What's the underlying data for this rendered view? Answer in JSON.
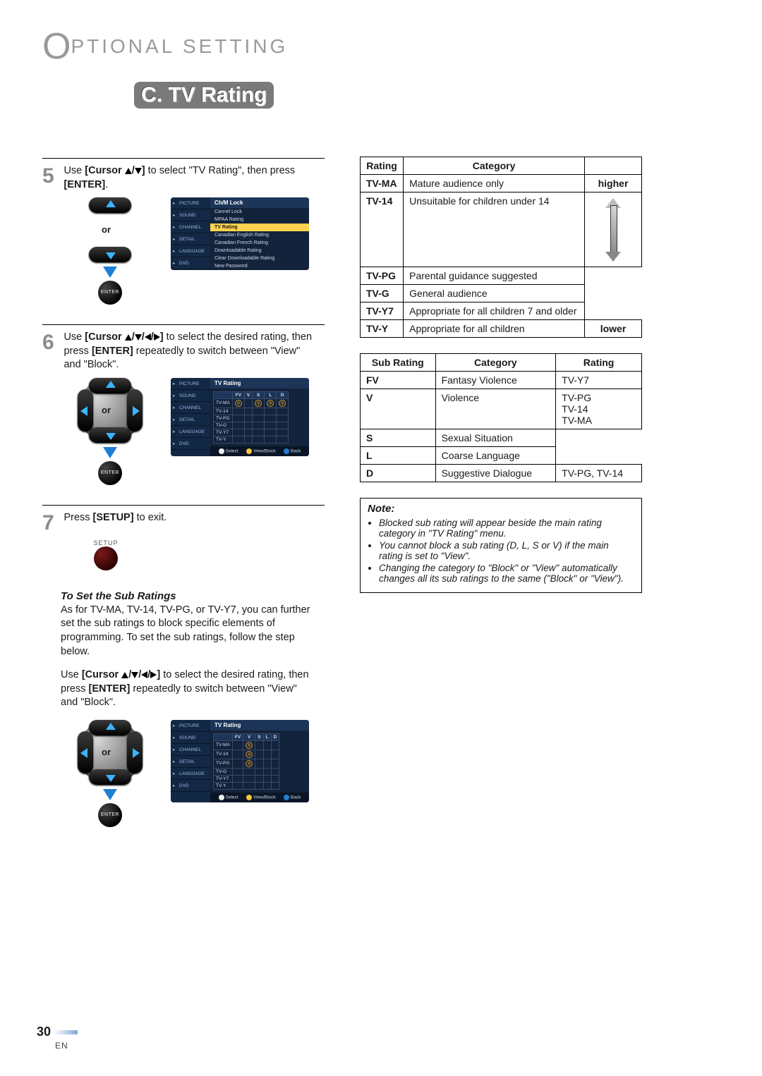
{
  "header": {
    "chapter_title": "PTIONAL   SETTING",
    "section_letter": "C.",
    "section_title": "TV Rating"
  },
  "steps": {
    "s5": {
      "num": "5",
      "text_pre": "Use ",
      "cursor_label": "[Cursor ",
      "text_mid": " to select \"TV Rating\", then press ",
      "enter_label": "[ENTER]",
      "text_post": "."
    },
    "s6": {
      "num": "6",
      "text_pre": "Use ",
      "cursor_label": "[Cursor ",
      "text_mid": " to select the desired rating, then press ",
      "enter_label": "[ENTER]",
      "text_post": " repeatedly to switch between \"View\" and \"Block\"."
    },
    "s7": {
      "num": "7",
      "text_pre": "Press ",
      "setup_label": "[SETUP]",
      "text_post": " to exit."
    }
  },
  "remote": {
    "or": "or",
    "enter": "ENTER",
    "setup": "SETUP"
  },
  "osd": {
    "tabs": [
      "PICTURE",
      "SOUND",
      "CHANNEL",
      "DETAIL",
      "LANGUAGE",
      "DVD"
    ],
    "menu_a": {
      "title": "Ch/M Lock",
      "items": [
        "Cannel Lock",
        "MPAA Rating",
        "TV Rating",
        "Canadian English Rating",
        "Canadian French Rating",
        "Downloadable Rating",
        "Clear Downloadable Rating",
        "New Password"
      ],
      "highlight": "TV Rating"
    },
    "menu_b": {
      "title": "TV Rating",
      "cols": [
        "",
        "FV",
        "V",
        "S",
        "L",
        "D"
      ],
      "rows": [
        "TV-MA",
        "TV-14",
        "TV-PG",
        "TV-G",
        "TV-Y7",
        "TV-Y"
      ],
      "footer": {
        "select": "Select",
        "view": "View/Block",
        "back": "Back"
      }
    },
    "menu_c": {
      "title": "TV Rating",
      "cols": [
        "",
        "FV",
        "V",
        "S",
        "L",
        "D"
      ],
      "rows": [
        "TV-MA",
        "TV-14",
        "TV-PG",
        "TV-G",
        "TV-Y7",
        "TV-Y"
      ],
      "footer": {
        "select": "Select",
        "view": "View/Block",
        "back": "Back"
      }
    }
  },
  "sub": {
    "heading": "To Set the Sub Ratings",
    "para1": "As for TV-MA, TV-14, TV-PG, or TV-Y7, you can further set the sub ratings to block specific elements of programming. To set the sub ratings, follow the step below.",
    "para2_pre": "Use ",
    "para2_cursor": "[Cursor ",
    "para2_mid": " to select the desired rating, then press ",
    "para2_enter": "[ENTER]",
    "para2_post": " repeatedly to switch between \"View\" and \"Block\"."
  },
  "rating_table": {
    "headers": [
      "Rating",
      "Category",
      ""
    ],
    "top_label": "higher",
    "bottom_label": "lower",
    "rows": [
      {
        "r": "TV-MA",
        "c": "Mature audience only"
      },
      {
        "r": "TV-14",
        "c": "Unsuitable for children under 14"
      },
      {
        "r": "TV-PG",
        "c": "Parental guidance suggested"
      },
      {
        "r": "TV-G",
        "c": "General audience"
      },
      {
        "r": "TV-Y7",
        "c": "Appropriate for all children 7 and older"
      },
      {
        "r": "TV-Y",
        "c": "Appropriate for all children"
      }
    ]
  },
  "sub_table": {
    "headers": [
      "Sub Rating",
      "Category",
      "Rating"
    ],
    "rows": [
      {
        "s": "FV",
        "c": "Fantasy Violence",
        "r": "TV-Y7"
      },
      {
        "s": "V",
        "c": "Violence",
        "r": ""
      },
      {
        "s": "S",
        "c": "Sexual Situation",
        "r": ""
      },
      {
        "s": "L",
        "c": "Coarse Language",
        "r": ""
      },
      {
        "s": "D",
        "c": "Suggestive Dialogue",
        "r": "TV-PG, TV-14"
      }
    ],
    "merged_ratings": "TV-PG\nTV-14\nTV-MA"
  },
  "note": {
    "title": "Note:",
    "items": [
      "Blocked sub rating will appear beside the main rating category in \"TV Rating\" menu.",
      "You cannot block a sub rating (D, L, S or V) if the main rating is set to \"View\".",
      "Changing the category to \"Block\" or \"View\" automatically changes all its sub ratings to the same (\"Block\" or \"View\")."
    ]
  },
  "footer": {
    "page": "30",
    "lang": "EN"
  }
}
